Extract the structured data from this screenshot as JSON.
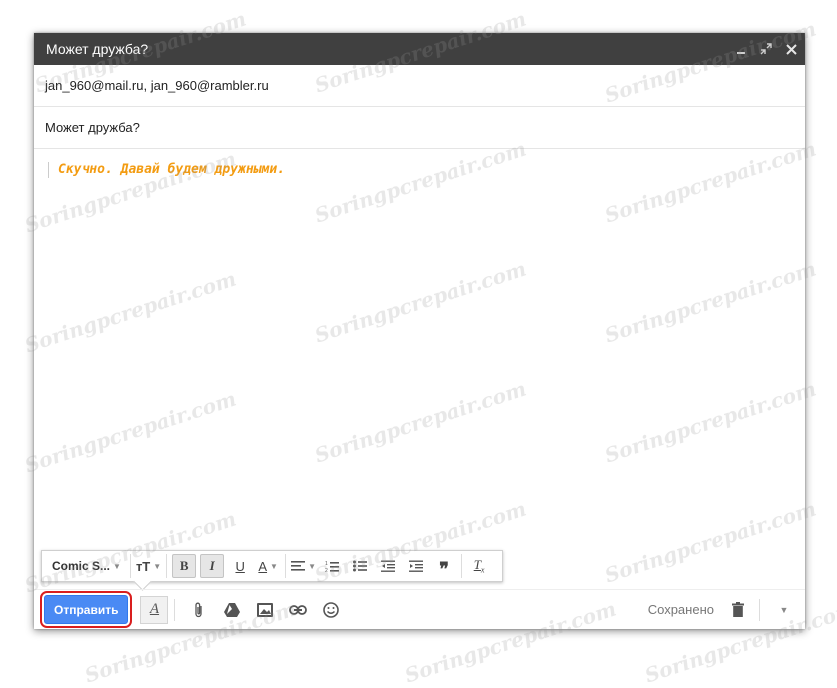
{
  "window": {
    "title": "Может дружба?",
    "recipients": "jan_960@mail.ru, jan_960@rambler.ru",
    "subject": "Может дружба?"
  },
  "message": {
    "text": "Скучно. Давай будем дружными."
  },
  "format_toolbar": {
    "font": "Comic S..."
  },
  "bottom": {
    "send_label": "Отправить",
    "status": "Сохранено"
  },
  "watermark": "Soringpcrepair.com",
  "icons": {
    "minimize": "minimize-icon",
    "popout": "popout-icon",
    "close": "close-icon",
    "font_size": "font-size-icon",
    "bold": "bold-icon",
    "italic": "italic-icon",
    "underline": "underline-icon",
    "text_color": "text-color-icon",
    "align": "align-icon",
    "numbered_list": "numbered-list-icon",
    "bulleted_list": "bulleted-list-icon",
    "indent_less": "indent-less-icon",
    "indent_more": "indent-more-icon",
    "quote": "quote-icon",
    "remove_formatting": "remove-formatting-icon",
    "attach": "paperclip-icon",
    "drive": "drive-icon",
    "photo": "photo-icon",
    "link": "link-icon",
    "emoji": "emoji-icon",
    "trash": "trash-icon",
    "more": "more-options-icon"
  },
  "colors": {
    "titlebar": "#404040",
    "send_button": "#4a8af4",
    "highlight": "#d91e1e",
    "message_text": "#f39c12"
  }
}
